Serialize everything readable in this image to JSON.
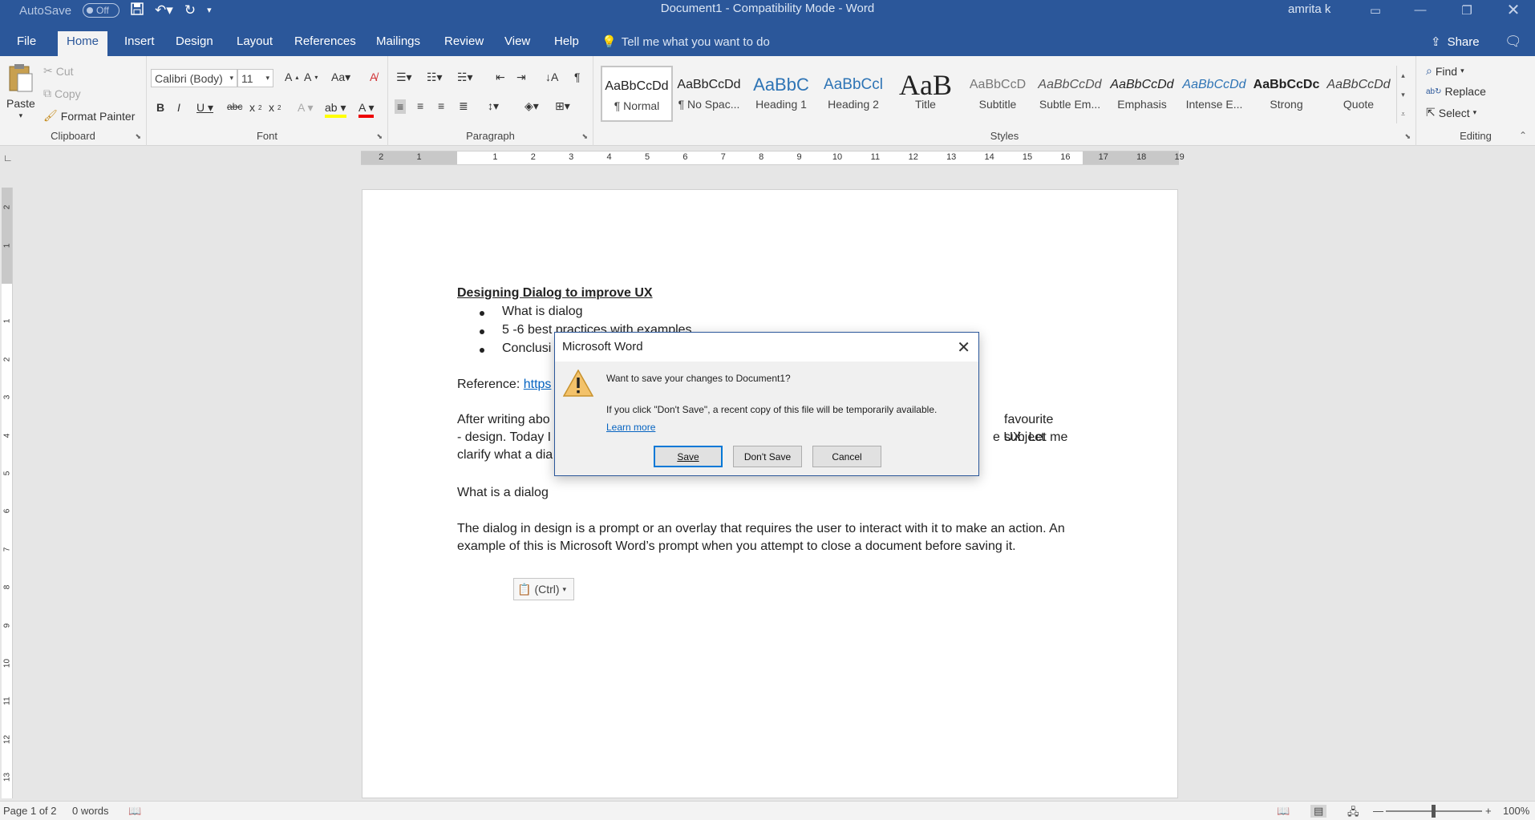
{
  "titlebar": {
    "autosave_label": "AutoSave",
    "autosave_state": "Off",
    "doc_title": "Document1  -  Compatibility Mode  -  Word",
    "user": "amrita k"
  },
  "tabs": [
    {
      "label": "File"
    },
    {
      "label": "Home"
    },
    {
      "label": "Insert"
    },
    {
      "label": "Design"
    },
    {
      "label": "Layout"
    },
    {
      "label": "References"
    },
    {
      "label": "Mailings"
    },
    {
      "label": "Review"
    },
    {
      "label": "View"
    },
    {
      "label": "Help"
    }
  ],
  "tell_me": "Tell me what you want to do",
  "share": "Share",
  "clipboard": {
    "paste": "Paste",
    "cut": "Cut",
    "copy": "Copy",
    "format_painter": "Format Painter",
    "label": "Clipboard"
  },
  "font": {
    "name": "Calibri (Body)",
    "size": "11",
    "label": "Font"
  },
  "paragraph": {
    "label": "Paragraph"
  },
  "styles": {
    "label": "Styles",
    "items": [
      {
        "sample": "AaBbCcDd",
        "name": "¶ Normal"
      },
      {
        "sample": "AaBbCcDd",
        "name": "¶ No Spac..."
      },
      {
        "sample": "AaBbC",
        "name": "Heading 1"
      },
      {
        "sample": "AaBbCcl",
        "name": "Heading 2"
      },
      {
        "sample": "AaB",
        "name": "Title"
      },
      {
        "sample": "AaBbCcD",
        "name": "Subtitle"
      },
      {
        "sample": "AaBbCcDd",
        "name": "Subtle Em..."
      },
      {
        "sample": "AaBbCcDd",
        "name": "Emphasis"
      },
      {
        "sample": "AaBbCcDd",
        "name": "Intense E..."
      },
      {
        "sample": "AaBbCcDc",
        "name": "Strong"
      },
      {
        "sample": "AaBbCcDd",
        "name": "Quote"
      }
    ]
  },
  "editing": {
    "find": "Find",
    "replace": "Replace",
    "select": "Select",
    "label": "Editing"
  },
  "document": {
    "heading": "Designing Dialog to improve UX",
    "bullets": [
      "What is dialog",
      "5 -6 best practices with examples",
      "Conclusi"
    ],
    "reference_label": "Reference:",
    "reference_link": "https",
    "para1_line1_a": "After writing abo",
    "para1_line1_b": "favourite subject",
    "para1_line2_a": "- design. Today I",
    "para1_line2_b": "e UX. Let me",
    "para1_line3_a": "clarify what a dia",
    "section_heading": "What is a dialog",
    "para2": "The dialog in design is a prompt or an overlay that requires the user to interact with it to make an action. An example of this is Microsoft Word’s prompt when you attempt to close a document before saving it.",
    "paste_options": "(Ctrl)"
  },
  "dialog": {
    "title": "Microsoft Word",
    "question": "Want to save your changes to Document1?",
    "info": "If you click \"Don't Save\", a recent copy of this file will be temporarily available.",
    "learn_more": "Learn more",
    "save": "Save",
    "dont_save": "Don't Save",
    "cancel": "Cancel"
  },
  "statusbar": {
    "page": "Page 1 of 2",
    "words": "0 words",
    "zoom": "100%"
  },
  "colors": {
    "accent": "#2b579a",
    "link": "#0563c1"
  }
}
